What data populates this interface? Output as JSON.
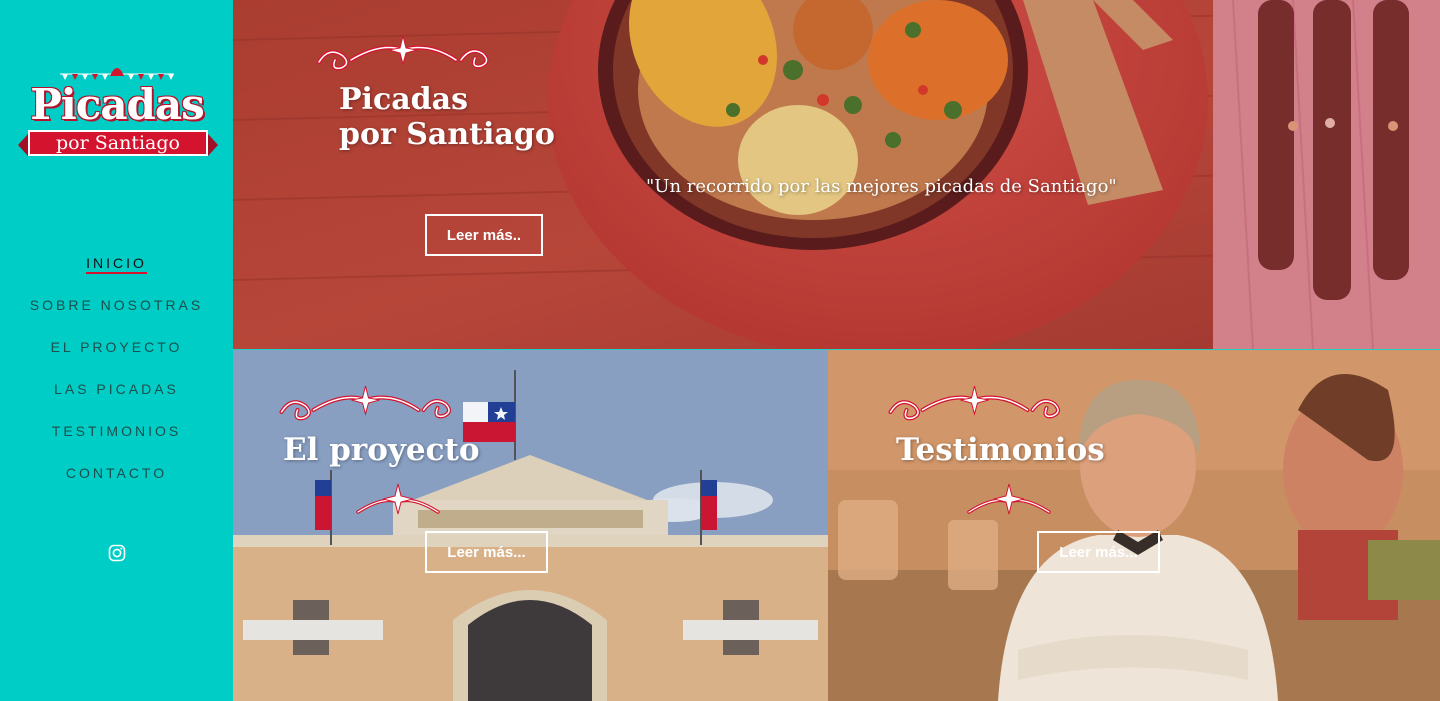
{
  "brand": {
    "title": "Picadas",
    "subtitle": "por Santiago"
  },
  "nav": {
    "items": [
      {
        "label": "INICIO",
        "active": true
      },
      {
        "label": "SOBRE NOSOTRAS",
        "active": false
      },
      {
        "label": "EL PROYECTO",
        "active": false
      },
      {
        "label": "LAS PICADAS",
        "active": false
      },
      {
        "label": "TESTIMONIOS",
        "active": false
      },
      {
        "label": "CONTACTO",
        "active": false
      }
    ],
    "social_icon": "instagram-icon"
  },
  "hero": {
    "title_line1": "Picadas",
    "title_line2": "por Santiago",
    "tagline": "\"Un recorrido por las mejores picadas de Santiago\"",
    "button_label": "Leer más.."
  },
  "project": {
    "title": "El proyecto",
    "button_label": "Leer más..."
  },
  "testimonials": {
    "title": "Testimonios",
    "button_label": "Leer más..."
  },
  "colors": {
    "sidebar": "#00cdc5",
    "accent_red": "#d4142f",
    "nav_text": "#1c4f4d"
  }
}
